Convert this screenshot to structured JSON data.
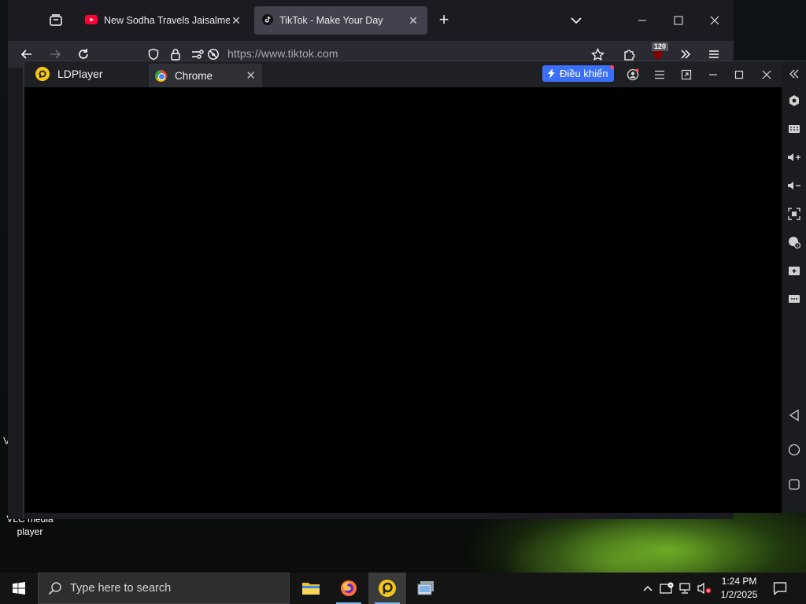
{
  "desktop": {
    "icon_label": "VLC media player",
    "edge_char": "V"
  },
  "firefox": {
    "tabs": [
      {
        "title": "New Sodha Travels Jaisalmer To",
        "favicon": "youtube-icon",
        "active": false
      },
      {
        "title": "TikTok - Make Your Day",
        "favicon": "tiktok-icon",
        "active": true
      }
    ],
    "url": "https://www.tiktok.com",
    "extension_badge": "120",
    "new_tab": "+",
    "close_glyph": "✕"
  },
  "ldplayer": {
    "brand": "LDPlayer",
    "tab_label": "Chrome",
    "control_button": "Điều khiển",
    "accent": "#3b6ff5",
    "screen_color": "#000000"
  },
  "taskbar": {
    "search_placeholder": "Type here to search",
    "apps": [
      "file-explorer-icon",
      "firefox-icon",
      "ldplayer-icon",
      "multi-instance-icon"
    ],
    "time": "1:24 PM",
    "date": "1/2/2025"
  }
}
